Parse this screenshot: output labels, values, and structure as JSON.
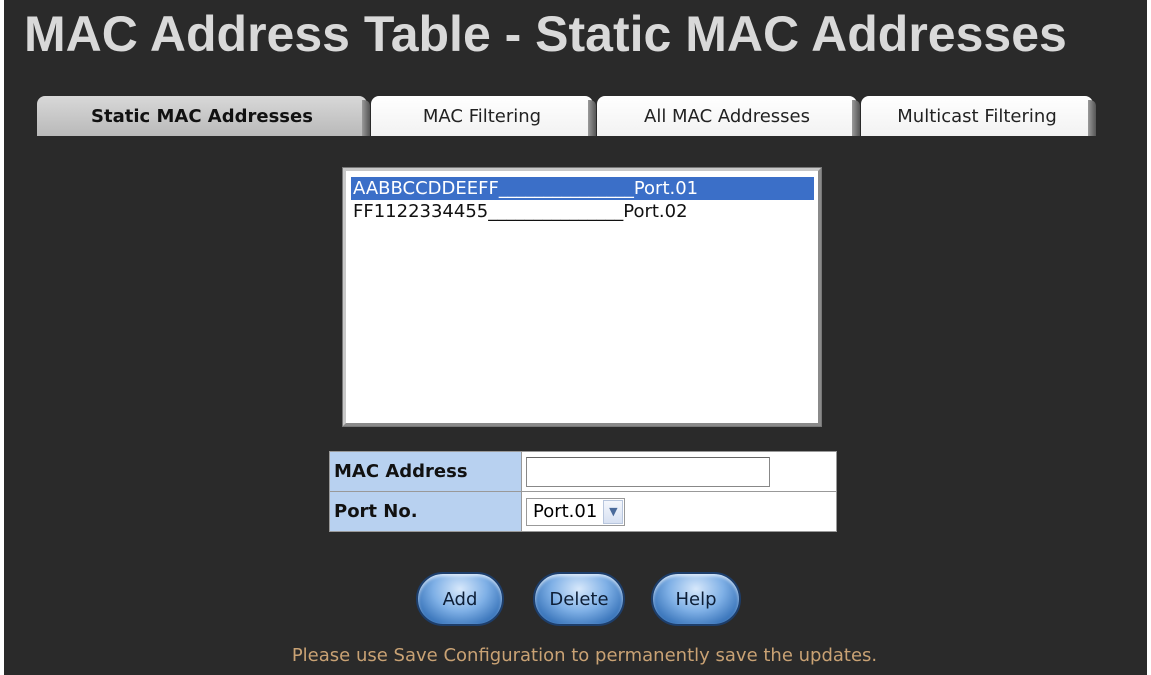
{
  "header": {
    "title": "MAC Address Table - Static MAC Addresses"
  },
  "tabs": [
    {
      "label": "Static MAC Addresses",
      "active": true
    },
    {
      "label": "MAC Filtering",
      "active": false
    },
    {
      "label": "All MAC Addresses",
      "active": false
    },
    {
      "label": "Multicast Filtering",
      "active": false
    }
  ],
  "mac_list": {
    "items": [
      {
        "text": "AABBCCDDEEFF_______________Port.01",
        "selected": true
      },
      {
        "text": "FF1122334455_______________Port.02",
        "selected": false
      }
    ]
  },
  "form": {
    "mac_address_label": "MAC Address",
    "mac_address_value": "",
    "port_label": "Port No.",
    "port_selected": "Port.01"
  },
  "buttons": {
    "add": "Add",
    "delete": "Delete",
    "help": "Help"
  },
  "footer": {
    "note": "Please use Save Configuration to permanently save the updates."
  },
  "colors": {
    "background": "#2a2a2a",
    "title": "#d9d9d9",
    "label_cell": "#b8d1f0",
    "selection": "#3b6fc8",
    "note": "#c9a274"
  }
}
